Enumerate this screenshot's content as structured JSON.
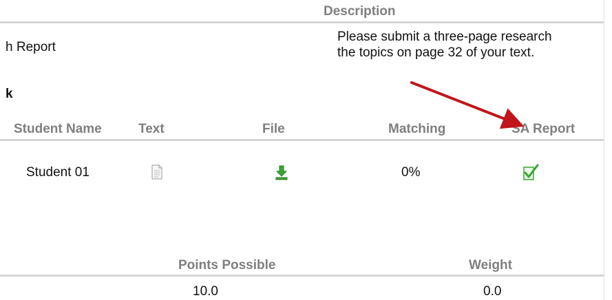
{
  "assignment": {
    "description_header": "Description",
    "title_fragment": "h Report",
    "description_line1": "Please submit a three-page research",
    "description_line2": "the topics on page 32 of your text."
  },
  "section": {
    "label_fragment": "k"
  },
  "submissions_table": {
    "headers": [
      "Student Name",
      "Text",
      "File",
      "Matching",
      "SA Report"
    ],
    "rows": [
      {
        "student_name": "Student 01",
        "text_icon": "document-icon",
        "file_icon": "download-icon",
        "matching": "0%",
        "sa_report_icon": "checked-report-icon"
      }
    ]
  },
  "grading": {
    "points_header": "Points Possible",
    "weight_header": "Weight",
    "points_value": "10.0",
    "weight_value": "0.0"
  },
  "colors": {
    "header_text": "#7f7f7f",
    "rule": "#d6d6d6",
    "annotation_arrow": "#c0161b",
    "icon_green": "#3aa532"
  }
}
